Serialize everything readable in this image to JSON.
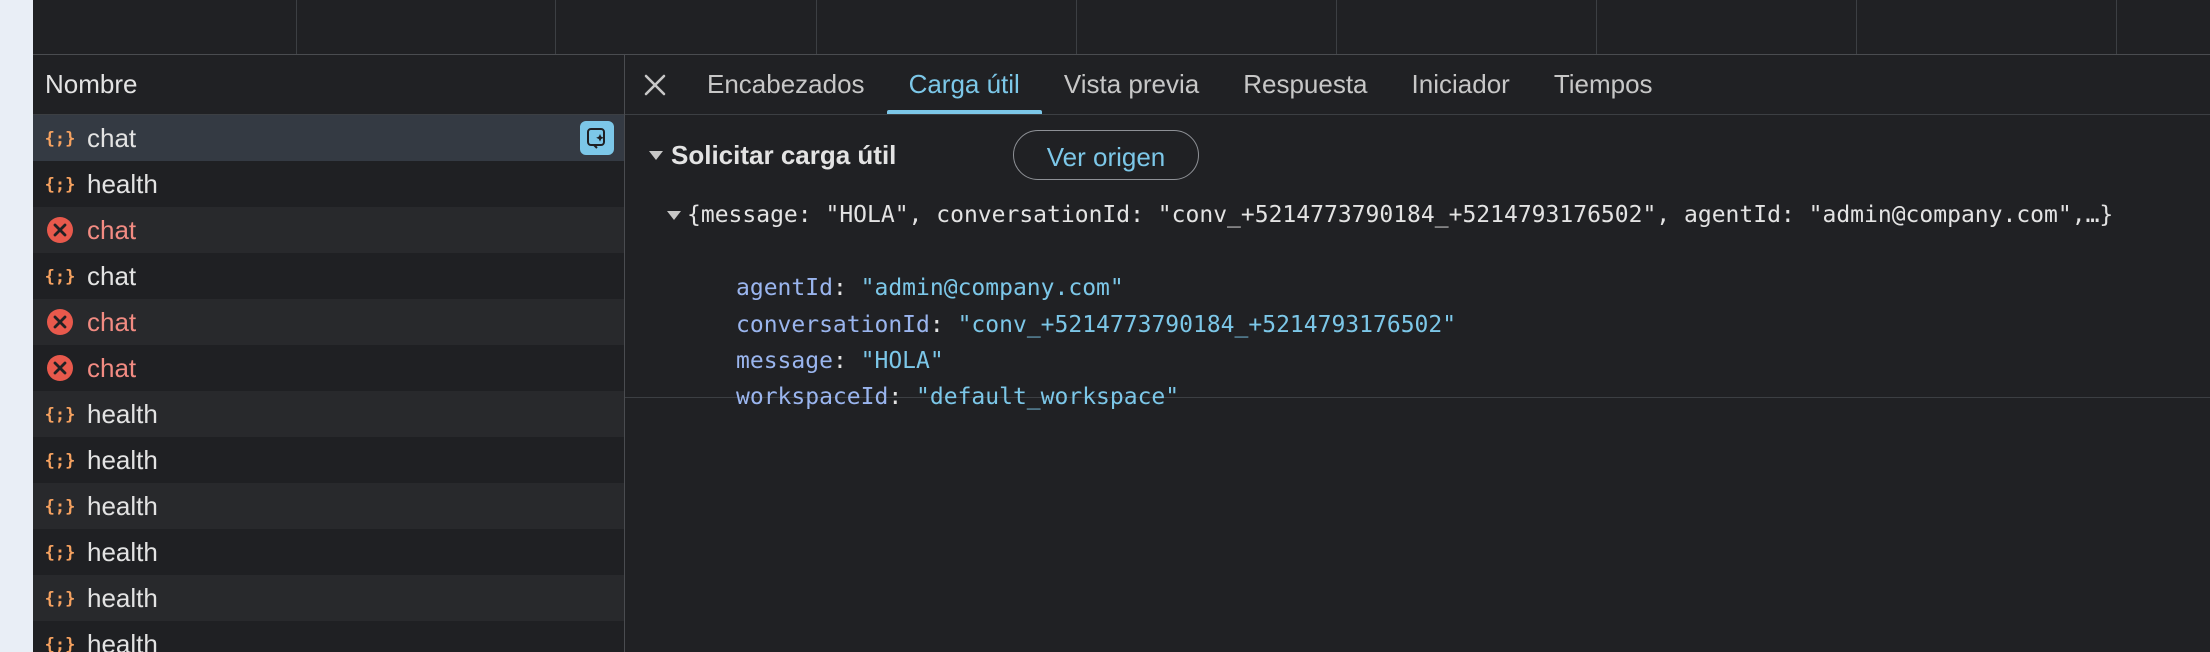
{
  "list": {
    "header": "Nombre",
    "rows": [
      {
        "name": "chat",
        "status": "ok"
      },
      {
        "name": "health",
        "status": "ok"
      },
      {
        "name": "chat",
        "status": "error"
      },
      {
        "name": "chat",
        "status": "ok"
      },
      {
        "name": "chat",
        "status": "error"
      },
      {
        "name": "chat",
        "status": "error"
      },
      {
        "name": "health",
        "status": "ok"
      },
      {
        "name": "health",
        "status": "ok"
      },
      {
        "name": "health",
        "status": "ok"
      },
      {
        "name": "health",
        "status": "ok"
      },
      {
        "name": "health",
        "status": "ok"
      },
      {
        "name": "health",
        "status": "ok"
      }
    ]
  },
  "tabs": [
    "Encabezados",
    "Carga útil",
    "Vista previa",
    "Respuesta",
    "Iniciador",
    "Tiempos"
  ],
  "active_tab": "Carga útil",
  "payload": {
    "section_title": "Solicitar carga útil",
    "view_source_label": "Ver origen",
    "summary": "{message: \"HOLA\", conversationId: \"conv_+5214773790184_+5214793176502\", agentId: \"admin@company.com\",…}",
    "properties": [
      {
        "key": "agentId",
        "value": "\"admin@company.com\""
      },
      {
        "key": "conversationId",
        "value": "\"conv_+5214773790184_+5214793176502\""
      },
      {
        "key": "message",
        "value": "\"HOLA\""
      },
      {
        "key": "workspaceId",
        "value": "\"default_workspace\""
      }
    ]
  },
  "colors": {
    "accent": "#7cc7e8",
    "error": "#f28b82",
    "fetch_icon": "#f6a260",
    "key": "#9ab5ee"
  },
  "icons": {
    "ok": "fetch-braces-icon",
    "error": "error-circle-icon",
    "close": "close-icon",
    "ai": "ai-assistant-icon",
    "expand": "triangle-down-icon"
  }
}
